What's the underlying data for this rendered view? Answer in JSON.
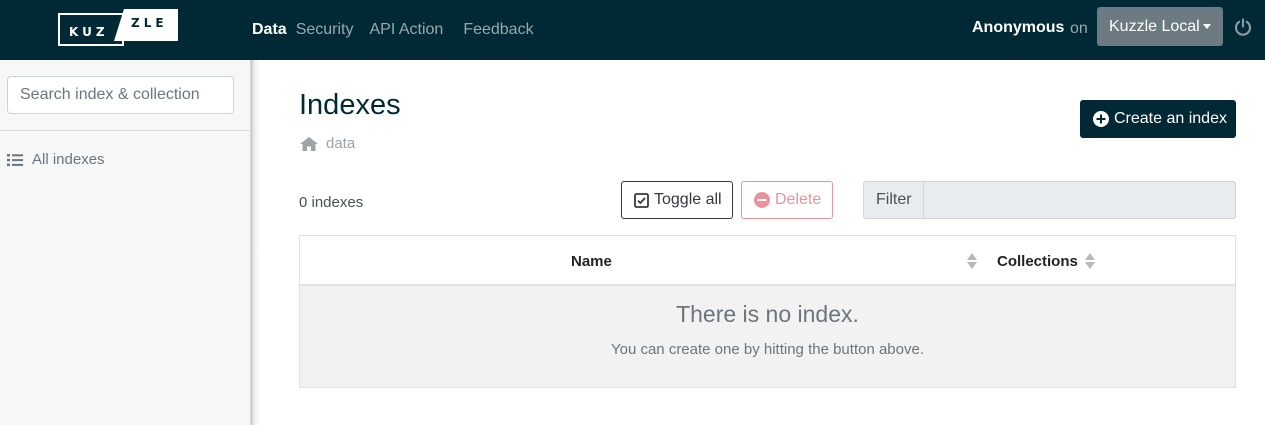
{
  "brand": {
    "logo_left": "KUZ",
    "logo_right": "ZLE"
  },
  "nav": {
    "items": [
      {
        "label": "Data"
      },
      {
        "label": "Security"
      },
      {
        "label": "API Action"
      },
      {
        "label": "Feedback"
      }
    ],
    "active": "Data"
  },
  "header": {
    "user": "Anonymous",
    "on_label": "on",
    "environment": "Kuzzle Local",
    "power_icon": "power-icon"
  },
  "sidebar": {
    "search_placeholder": "Search index & collection",
    "all_indexes_label": "All indexes",
    "list_icon": "list-icon"
  },
  "main": {
    "title": "Indexes",
    "breadcrumb": "data",
    "breadcrumb_icon": "home-icon",
    "create_button": "Create an index",
    "count_label": "0 indexes",
    "toggle_all": "Toggle all",
    "delete": "Delete",
    "filter_label": "Filter",
    "filter_value": ""
  },
  "table": {
    "columns": [
      "Name",
      "Collections"
    ],
    "empty_title": "There is no index.",
    "empty_subtitle": "You can create one by hitting the button above."
  },
  "colors": {
    "topbar": "#002835",
    "primary": "#002835",
    "danger": "#e8949d",
    "env_button": "#6c7a82"
  }
}
